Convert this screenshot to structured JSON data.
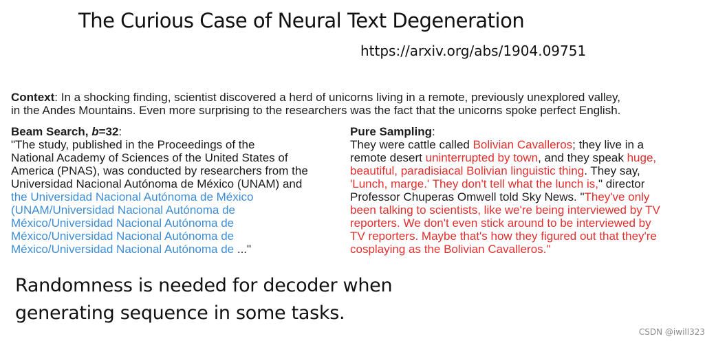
{
  "slide": {
    "title": "The Curious Case of Neural Text Degeneration",
    "url": "https://arxiv.org/abs/1904.09751"
  },
  "context": {
    "label": "Context",
    "line1": ": In a shocking finding, scientist discovered a herd of unicorns living in a remote, previously unexplored valley,",
    "line2": "in the Andes Mountains. Even more surprising to the researchers was the fact that the unicorns spoke perfect English."
  },
  "beam_search": {
    "label_prefix": "Beam Search, ",
    "label_b": "b",
    "label_suffix": "=32",
    "label_colon": ":",
    "lines": [
      "\"The study, published in the Proceedings of the",
      "National Academy of Sciences of the United States of",
      "America (PNAS), was conducted by researchers from the",
      "Universidad Nacional Autónoma de México (UNAM) and"
    ],
    "repeated_lines": [
      "the Universidad Nacional Autónoma de México",
      "(UNAM/Universidad Nacional Autónoma de",
      "México/Universidad Nacional Autónoma de",
      "México/Universidad Nacional Autónoma de",
      "México/Universidad Nacional Autónoma de"
    ],
    "ending": " ...\""
  },
  "pure_sampling": {
    "label": "Pure Sampling",
    "label_colon": ":",
    "l1_a": "They were cattle called ",
    "l1_b": "Bolivian Cavalleros",
    "l1_c": "; they live in a",
    "l2_a": "remote desert ",
    "l2_b": "uninterrupted by town",
    "l2_c": ", and they speak ",
    "l2_d": "huge,",
    "l3_a": "beautiful, paradisiacal Bolivian linguistic thing",
    "l3_b": ". They say,",
    "l4_a": "'Lunch, marge.' They don't tell what the lunch is,",
    "l4_b": "\" director",
    "l5_a": "Professor Chuperas Omwell told Sky News. \"",
    "l5_b": "They've only",
    "l6": "been talking to scientists, like we're being interviewed by TV",
    "l7": "reporters. We don't even stick around to be interviewed by",
    "l8": "TV reporters. Maybe that's how they figured out that they're",
    "l9": "cosplaying as the Bolivian Cavalleros.\""
  },
  "conclusion": {
    "line1": "Randomness is needed for decoder when",
    "line2": "generating sequence in some tasks."
  },
  "watermark": "CSDN @iwill323",
  "colors": {
    "repetition": "#3d8dd6",
    "incoherent": "#e0302e"
  }
}
